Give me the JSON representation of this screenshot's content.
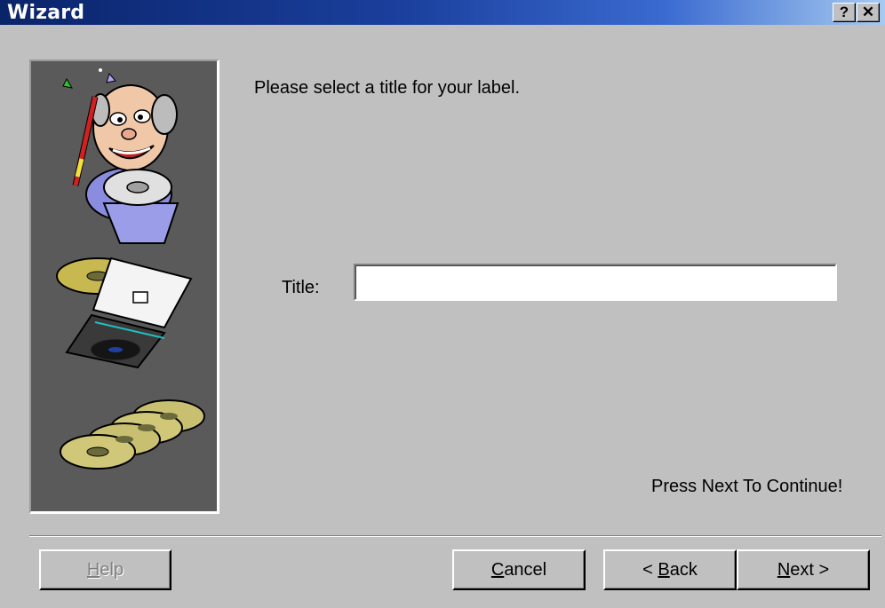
{
  "window": {
    "title": "Wizard",
    "help_glyph": "?",
    "close_glyph": "✕"
  },
  "content": {
    "instruction": "Please select a title for your label.",
    "title_label": "Title:",
    "title_value": "",
    "footer_note": "Press Next To Continue!"
  },
  "buttons": {
    "help": {
      "access": "H",
      "rest": "elp",
      "enabled": false
    },
    "cancel": {
      "access": "C",
      "rest": "ancel",
      "enabled": true
    },
    "back": {
      "prefix": "< ",
      "access": "B",
      "rest": "ack",
      "enabled": true
    },
    "next": {
      "access": "N",
      "rest": "ext >",
      "enabled": true
    }
  },
  "colors": {
    "titlebar_start": "#0a246a",
    "titlebar_end": "#a6caf0",
    "dialog_face": "#c0c0c0",
    "art_background": "#5a5a5a"
  },
  "icons": [
    "help-question-icon",
    "close-icon",
    "wizard-magician-art",
    "cd-disc-art",
    "cd-jewel-case-art",
    "cd-stack-art"
  ]
}
